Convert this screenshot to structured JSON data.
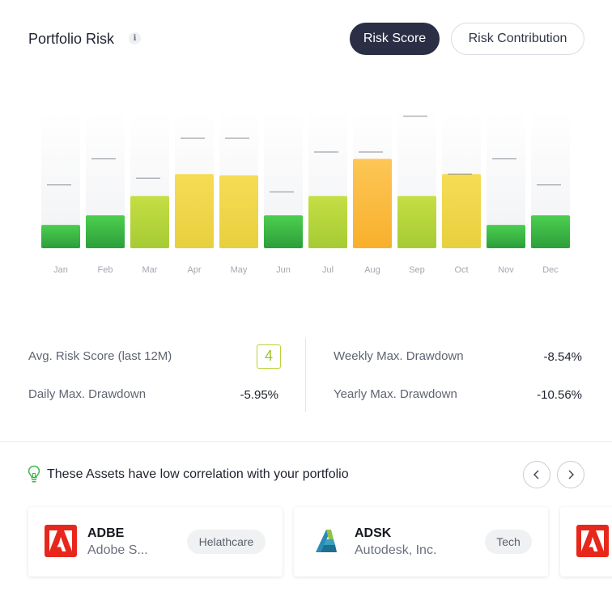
{
  "header": {
    "title": "Portfolio Risk",
    "info_icon": "i",
    "toggles": [
      {
        "label": "Risk Score",
        "active": true
      },
      {
        "label": "Risk Contribution",
        "active": false
      }
    ]
  },
  "chart_data": {
    "type": "bar",
    "categories": [
      "Jan",
      "Feb",
      "Mar",
      "Apr",
      "May",
      "Jun",
      "Jul",
      "Aug",
      "Sep",
      "Oct",
      "Nov",
      "Dec"
    ],
    "series": [
      {
        "values": [
          1.7,
          2.4,
          3.8,
          5.4,
          5.3,
          2.4,
          3.8,
          6.5,
          3.8,
          5.4,
          1.7,
          2.4
        ]
      },
      {
        "values": [
          4.6,
          6.5,
          5.1,
          8.0,
          8.0,
          4.1,
          7.0,
          7.0,
          9.6,
          5.4,
          6.5,
          4.6
        ]
      }
    ],
    "ylim": [
      0,
      10
    ],
    "grid": false,
    "colors": {
      "low": "#3db84a",
      "mid": "#b8d43a",
      "high": "#f2d84a",
      "peak": "#fbb63c"
    }
  },
  "stats": {
    "avg_risk_label": "Avg. Risk Score (last 12M)",
    "avg_risk_value": "4",
    "daily_label": "Daily Max. Drawdown",
    "daily_value": "-5.95%",
    "weekly_label": "Weekly Max. Drawdown",
    "weekly_value": "-8.54%",
    "yearly_label": "Yearly Max. Drawdown",
    "yearly_value": "-10.56%"
  },
  "suggestions": {
    "title": "These Assets have low correlation with your portfolio",
    "cards": [
      {
        "ticker": "ADBE",
        "company": "Adobe S...",
        "sector": "Helathcare",
        "logo": "adobe-logo"
      },
      {
        "ticker": "ADSK",
        "company": "Autodesk, Inc.",
        "sector": "Tech",
        "logo": "autodesk-logo"
      },
      {
        "ticker": "",
        "company": "",
        "sector": "",
        "logo": "adobe-logo"
      }
    ]
  }
}
